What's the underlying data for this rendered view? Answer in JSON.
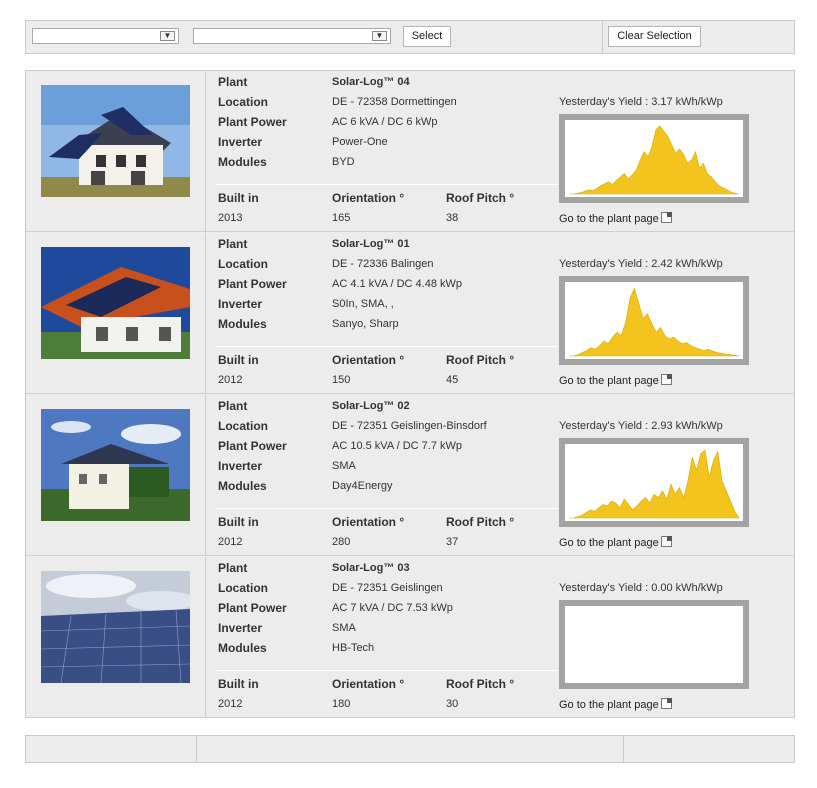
{
  "filters": {
    "select1_value": "",
    "select2_value": "",
    "select_button": "Select",
    "clear_button": "Clear Selection"
  },
  "labels": {
    "plant": "Plant",
    "location": "Location",
    "plant_power": "Plant Power",
    "inverter": "Inverter",
    "modules": "Modules",
    "built_in": "Built in",
    "orientation": "Orientation °",
    "roof_pitch": "Roof Pitch °",
    "goto": "Go to the plant page"
  },
  "plants": [
    {
      "name": "Solar-Log™ 04",
      "location": "DE - 72358 Dormettingen",
      "power": "AC 6 kVA / DC 6 kWp",
      "inverter": "Power-One",
      "modules": "BYD",
      "built_in": "2013",
      "orientation": "165",
      "roof_pitch": "38",
      "yield": "Yesterday's Yield : 3.17 kWh/kWp",
      "chart_data": {
        "type": "area",
        "color": "#f2c41d",
        "values": [
          0,
          0,
          0.01,
          0.02,
          0.04,
          0.06,
          0.05,
          0.08,
          0.12,
          0.15,
          0.18,
          0.14,
          0.2,
          0.25,
          0.3,
          0.22,
          0.28,
          0.35,
          0.5,
          0.62,
          0.55,
          0.7,
          0.95,
          1.0,
          0.92,
          0.85,
          0.72,
          0.6,
          0.66,
          0.58,
          0.45,
          0.5,
          0.62,
          0.38,
          0.45,
          0.3,
          0.25,
          0.18,
          0.12,
          0.09,
          0.06,
          0.03,
          0.01,
          0
        ]
      }
    },
    {
      "name": "Solar-Log™ 01",
      "location": "DE - 72336 Balingen",
      "power": "AC 4.1 kVA / DC 4.48 kWp",
      "inverter": "S0In, SMA, ,",
      "modules": "Sanyo, Sharp",
      "built_in": "2012",
      "orientation": "150",
      "roof_pitch": "45",
      "yield": "Yesterday's Yield : 2.42 kWh/kWp",
      "chart_data": {
        "type": "area",
        "color": "#f2c41d",
        "values": [
          0,
          0,
          0.02,
          0.05,
          0.08,
          0.12,
          0.1,
          0.15,
          0.22,
          0.18,
          0.28,
          0.35,
          0.3,
          0.5,
          0.85,
          1.0,
          0.78,
          0.55,
          0.62,
          0.48,
          0.35,
          0.42,
          0.3,
          0.25,
          0.28,
          0.22,
          0.18,
          0.2,
          0.15,
          0.12,
          0.1,
          0.08,
          0.1,
          0.07,
          0.05,
          0.04,
          0.03,
          0.02,
          0.01,
          0
        ]
      }
    },
    {
      "name": "Solar-Log™ 02",
      "location": "DE - 72351 Geislingen-Binsdorf",
      "power": "AC 10.5 kVA / DC 7.7 kWp",
      "inverter": "SMA",
      "modules": "Day4Energy",
      "built_in": "2012",
      "orientation": "280",
      "roof_pitch": "37",
      "yield": "Yesterday's Yield : 2.93 kWh/kWp",
      "chart_data": {
        "type": "area",
        "color": "#f2c41d",
        "values": [
          0,
          0,
          0.02,
          0.04,
          0.08,
          0.12,
          0.1,
          0.15,
          0.2,
          0.18,
          0.25,
          0.22,
          0.15,
          0.28,
          0.2,
          0.12,
          0.18,
          0.25,
          0.3,
          0.22,
          0.35,
          0.3,
          0.4,
          0.28,
          0.5,
          0.35,
          0.45,
          0.3,
          0.55,
          0.9,
          0.7,
          0.95,
          1.0,
          0.6,
          0.85,
          0.98,
          0.55,
          0.4,
          0.25,
          0.1,
          0
        ]
      }
    },
    {
      "name": "Solar-Log™ 03",
      "location": "DE - 72351 Geislingen",
      "power": "AC 7 kVA / DC 7.53 kWp",
      "inverter": "SMA",
      "modules": "HB-Tech",
      "built_in": "2012",
      "orientation": "180",
      "roof_pitch": "30",
      "yield": "Yesterday's Yield : 0.00 kWh/kWp",
      "chart_data": {
        "type": "area",
        "color": "#f2c41d",
        "values": []
      }
    }
  ]
}
